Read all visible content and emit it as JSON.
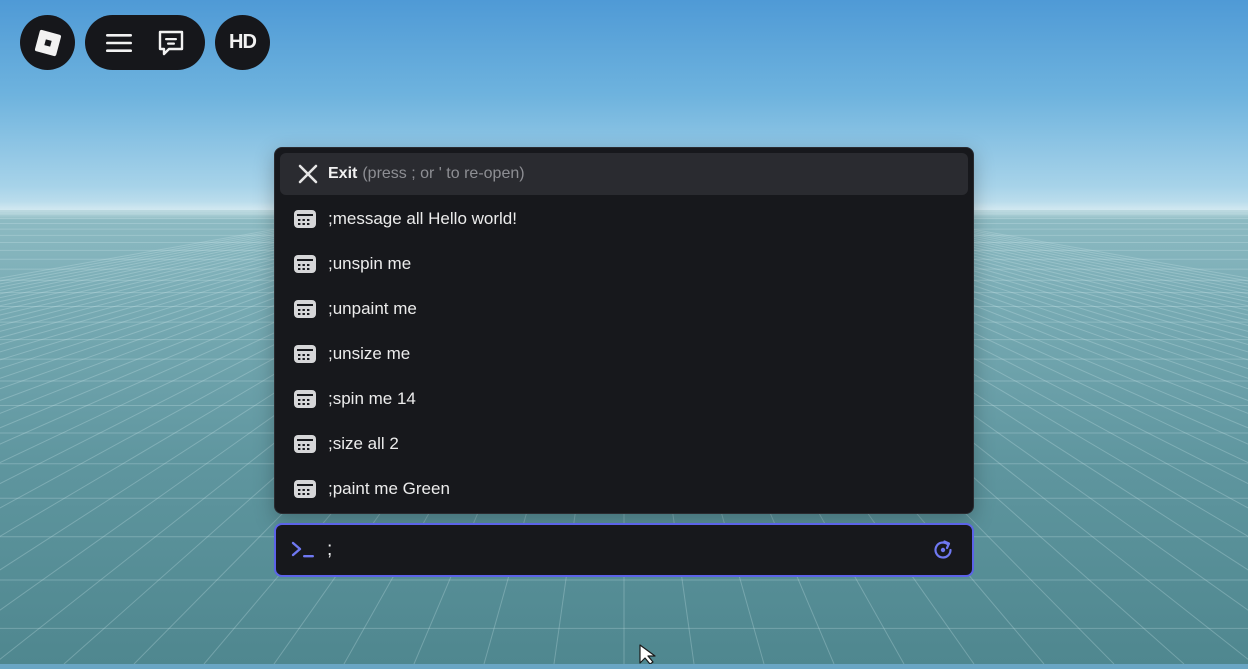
{
  "topbar": {
    "roblox_icon": "roblox-logo-icon",
    "menu_icon": "hamburger-menu-icon",
    "chat_icon": "chat-bubble-icon",
    "hd_label": "HD"
  },
  "palette": {
    "exit_label": "Exit",
    "exit_hint": "(press ; or ' to re-open)",
    "exit_icon": "close-icon",
    "command_icon": "command-history-icon",
    "commands": [
      {
        "text": ";message all Hello world!"
      },
      {
        "text": ";unspin me"
      },
      {
        "text": ";unpaint me"
      },
      {
        "text": ";unsize me"
      },
      {
        "text": ";spin me 14"
      },
      {
        "text": ";size all 2"
      },
      {
        "text": ";paint me Green"
      }
    ]
  },
  "input_bar": {
    "value": ";",
    "prompt_icon": "terminal-prompt-icon",
    "refresh_icon": "refresh-icon"
  },
  "colors": {
    "panel_bg": "#17181c",
    "exit_row_bg": "#2a2b30",
    "accent": "#5b63e8",
    "text_primary": "#ececec",
    "text_muted": "#8d8e93"
  }
}
